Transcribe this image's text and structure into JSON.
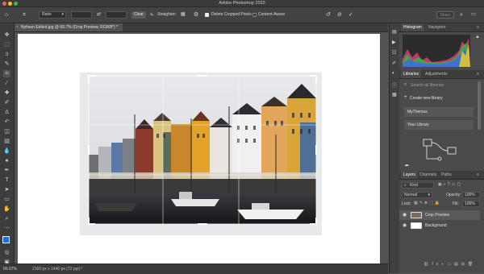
{
  "app": {
    "title": "Adobe Photoshop 2023"
  },
  "window_controls": {
    "colors": [
      "#fe5f57",
      "#febc2e",
      "#28c840"
    ]
  },
  "options_bar": {
    "ratio_label": "Ratio",
    "clear_label": "Clear",
    "straighten_label": "Straighten",
    "delete_cropped_label": "Delete Cropped Pixels",
    "content_aware_label": "Content-Aware",
    "share_label": "Share"
  },
  "document": {
    "tab_label": "Nyhavn Edited.jpg @ 66.7% (Crop Preview, RGB/8*) *"
  },
  "status": {
    "zoom": "66.67%",
    "dimensions": "2160 px x 1440 px (72 ppi)"
  },
  "panels": {
    "histogram_tab": "Histogram",
    "navigator_tab": "Navigator",
    "libraries_tab": "Libraries",
    "adjustments_tab": "Adjustments",
    "search_placeholder": "Search all libraries",
    "create_library": "Create new library",
    "libraries": [
      "MyThemes",
      "Your Library"
    ],
    "layers_tab": "Layers",
    "channels_tab": "Channels",
    "paths_tab": "Paths",
    "kind_label": "Kind",
    "blend_mode": "Normal",
    "opacity_label": "Opacity:",
    "opacity_value": "100%",
    "lock_label": "Lock:",
    "fill_label": "Fill:",
    "fill_value": "100%",
    "layers": [
      "Crop Preview",
      "Background"
    ]
  }
}
